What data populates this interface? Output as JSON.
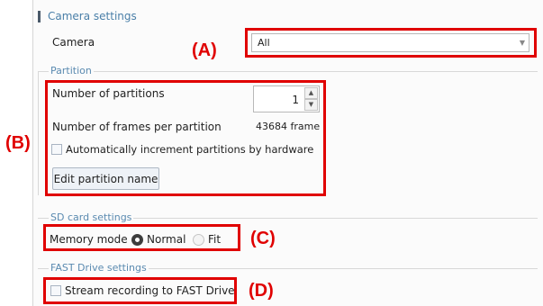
{
  "camera_settings": {
    "title": "Camera settings",
    "camera_label": "Camera",
    "camera_value": "All"
  },
  "partition": {
    "title": "Partition",
    "num_partitions_label": "Number of partitions",
    "num_partitions_value": "1",
    "frames_label": "Number of frames per partition",
    "frames_value": "43684 frame",
    "auto_increment_label": "Automatically increment partitions by hardware",
    "auto_increment_checked": false,
    "edit_button_label": "Edit partition name"
  },
  "sd_card": {
    "title": "SD card settings",
    "memory_mode_label": "Memory mode",
    "options": [
      "Normal",
      "Fit"
    ],
    "selected": "Normal"
  },
  "fast_drive": {
    "title": "FAST Drive settings",
    "stream_label": "Stream recording to FAST Drive",
    "stream_checked": false
  },
  "callouts": {
    "a": "(A)",
    "b": "(B)",
    "c": "(C)",
    "d": "(D)"
  },
  "colors": {
    "callout": "#e00000",
    "section_title": "#4a7fa8",
    "group_title": "#5a8ab0"
  }
}
